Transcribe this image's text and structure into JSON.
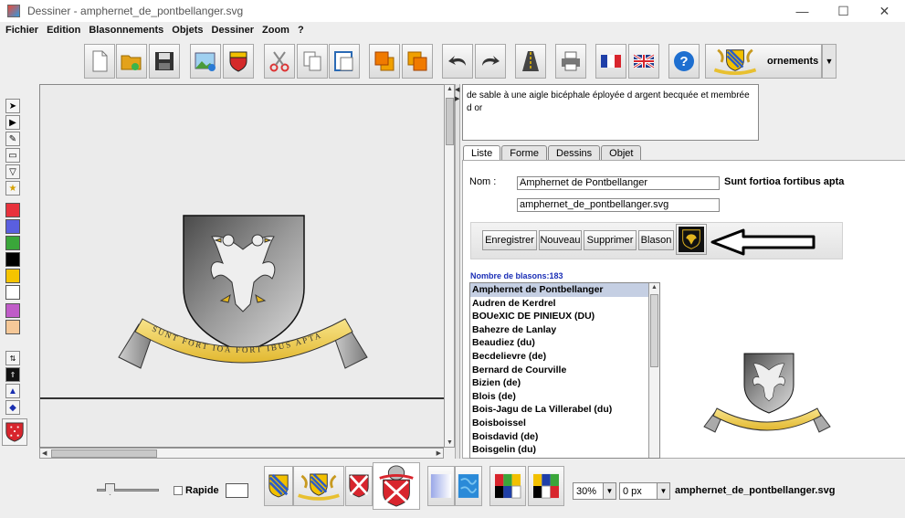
{
  "window": {
    "title": "Dessiner - amphernet_de_pontbellanger.svg"
  },
  "menu": [
    "Fichier",
    "Edition",
    "Blasonnements",
    "Objets",
    "Dessiner",
    "Zoom",
    "?"
  ],
  "toolbar": {
    "ornements_label": "ornements"
  },
  "description": "de sable à une aigle bicéphale éployée d argent becquée et membrée d or",
  "tabs": [
    "Liste",
    "Forme",
    "Dessins",
    "Objet"
  ],
  "form": {
    "nom_label": "Nom :",
    "nom_value": "Amphernet de Pontbellanger",
    "file_value": "amphernet_de_pontbellanger.svg",
    "motto": "Sunt fortioa fortibus apta"
  },
  "buttons": {
    "enregistrer": "Enregistrer",
    "nouveau": "Nouveau",
    "supprimer": "Supprimer",
    "blason": "Blason"
  },
  "count_label": "Nombre de blasons:183",
  "list": [
    "Amphernet de Pontbellanger",
    "Audren de Kerdrel",
    "BOUeXIC DE PINIEUX (DU)",
    "Bahezre de Lanlay",
    "Beaudiez (du)",
    "Becdelievre (de)",
    "Bernard de Courville",
    "Bizien (de)",
    "Blois (de)",
    "Bois-Jagu de La Villerabel (du)",
    "Boisboissel",
    "Boisdavid (de)",
    "Boisgelin (du)"
  ],
  "scroll": "amphernet",
  "motto_ribbon": "SUNT FORT IOA FORT IBUS APTA",
  "bottom": {
    "rapide_label": "Rapide",
    "zoom_value": "30%",
    "px_value": "0 px",
    "filename": "amphernet_de_pontbellanger.svg"
  },
  "colors": {
    "palette": [
      "#e8323c",
      "#5a5fe0",
      "#3aa63a",
      "#000000",
      "#f5c400",
      "#ffffff",
      "#c05cc8",
      "#f5c898"
    ],
    "accent_blue": "#1b2fb6",
    "selection": "#c5cfe3"
  }
}
